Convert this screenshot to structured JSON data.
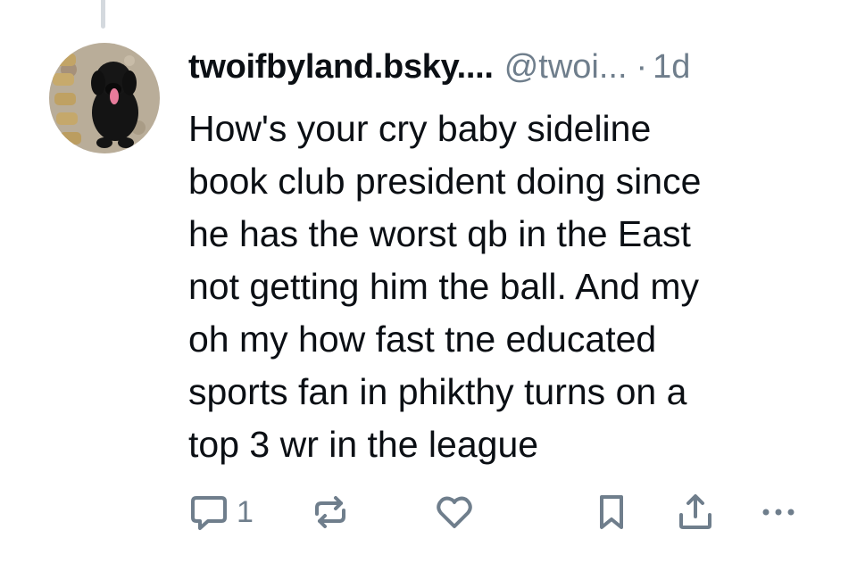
{
  "post": {
    "author_name": "twoifbyland.bsky....",
    "handle": "@twoi...",
    "separator": "·",
    "time": "1d",
    "text": "How's your cry baby sideline\nbook club president doing since\nhe has the worst qb in the East\nnot getting him the ball. And my\noh my how fast tne educated\nsports fan in phikthy turns on a\ntop 3 wr in the league"
  },
  "actions": {
    "reply_count": "1",
    "icons": [
      "reply-icon",
      "repost-icon",
      "like-icon",
      "bookmark-icon",
      "share-icon",
      "more-icon"
    ]
  },
  "colors": {
    "text": "#0b0f14",
    "muted": "#6f7e8c",
    "thread_line": "#d4d9de"
  }
}
